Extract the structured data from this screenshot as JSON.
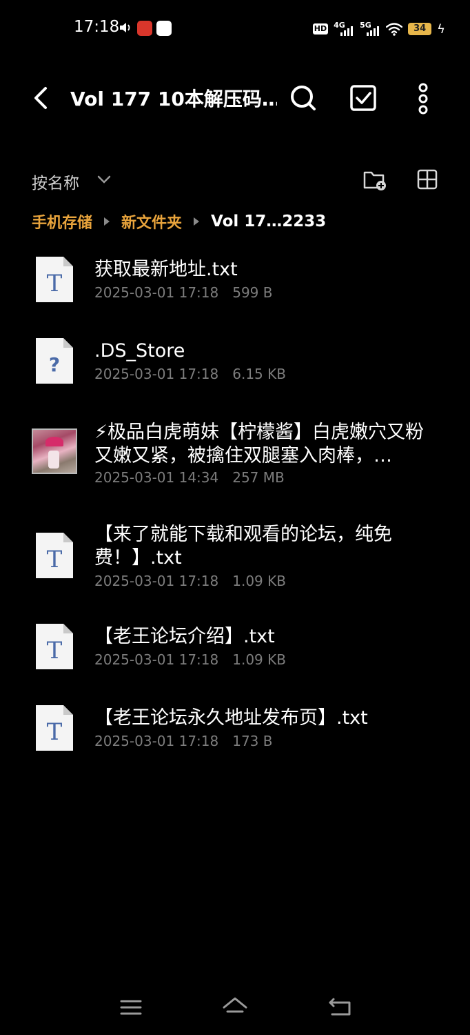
{
  "status_bar": {
    "time": "17:18",
    "hd": "HD",
    "net1": "4G",
    "net2": "5G",
    "battery": "34"
  },
  "toolbar": {
    "title": "Vol 177 10本解压码…"
  },
  "sort": {
    "label": "按名称"
  },
  "breadcrumb": {
    "items": [
      "手机存储",
      "新文件夹",
      "Vol 17…2233"
    ]
  },
  "files": [
    {
      "name": "获取最新地址.txt",
      "date": "2025-03-01 17:18",
      "size": "599 B",
      "icon": "text-file-icon",
      "glyph": "T"
    },
    {
      "name": ".DS_Store",
      "date": "2025-03-01 17:18",
      "size": "6.15 KB",
      "icon": "unknown-file-icon",
      "glyph": "?"
    },
    {
      "name": "⚡极品白虎萌妹【柠檬酱】白虎嫩穴又粉又嫩又紧，被擒住双腿塞入肉棒，…",
      "date": "2025-03-01 14:34",
      "size": "257 MB",
      "icon": "video-thumbnail"
    },
    {
      "name": "【来了就能下载和观看的论坛，纯免费！】.txt",
      "date": "2025-03-01 17:18",
      "size": "1.09 KB",
      "icon": "text-file-icon",
      "glyph": "T"
    },
    {
      "name": "【老王论坛介绍】.txt",
      "date": "2025-03-01 17:18",
      "size": "1.09 KB",
      "icon": "text-file-icon",
      "glyph": "T"
    },
    {
      "name": "【老王论坛永久地址发布页】.txt",
      "date": "2025-03-01 17:18",
      "size": "173 B",
      "icon": "text-file-icon",
      "glyph": "T"
    }
  ],
  "colors": {
    "breadcrumb_link": "#e9a43c",
    "meta_text": "#7d7d7d",
    "file_glyph": "#4a6aa8",
    "battery": "#e7b64a"
  }
}
